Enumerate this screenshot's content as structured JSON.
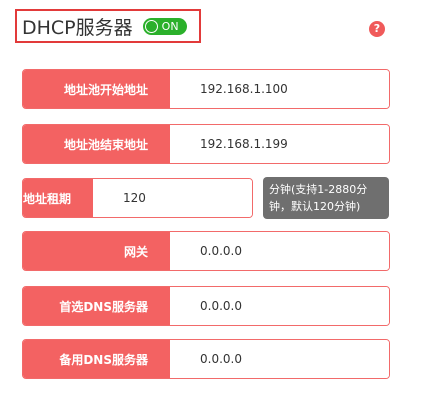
{
  "header": {
    "title": "DHCP服务器",
    "toggle_label": "ON",
    "help_glyph": "?"
  },
  "fields": [
    {
      "label": "地址池开始地址",
      "value": "192.168.1.100"
    },
    {
      "label": "地址池结束地址",
      "value": "192.168.1.199"
    },
    {
      "label": "地址租期",
      "value": "120"
    },
    {
      "label": "网关",
      "value": "0.0.0.0"
    },
    {
      "label": "首选DNS服务器",
      "value": "0.0.0.0"
    },
    {
      "label": "备用DNS服务器",
      "value": "0.0.0.0"
    }
  ],
  "lease_hint": {
    "line1": "分钟(支持1-2880分",
    "line2": "钟，默认120分钟)"
  },
  "colors": {
    "accent": "#f36262",
    "header_border": "#e23a3a",
    "toggle_on": "#2bb02b",
    "tooltip_bg": "#6f6f6f"
  },
  "icons": {
    "help": "help-icon",
    "toggle": "toggle-switch"
  }
}
